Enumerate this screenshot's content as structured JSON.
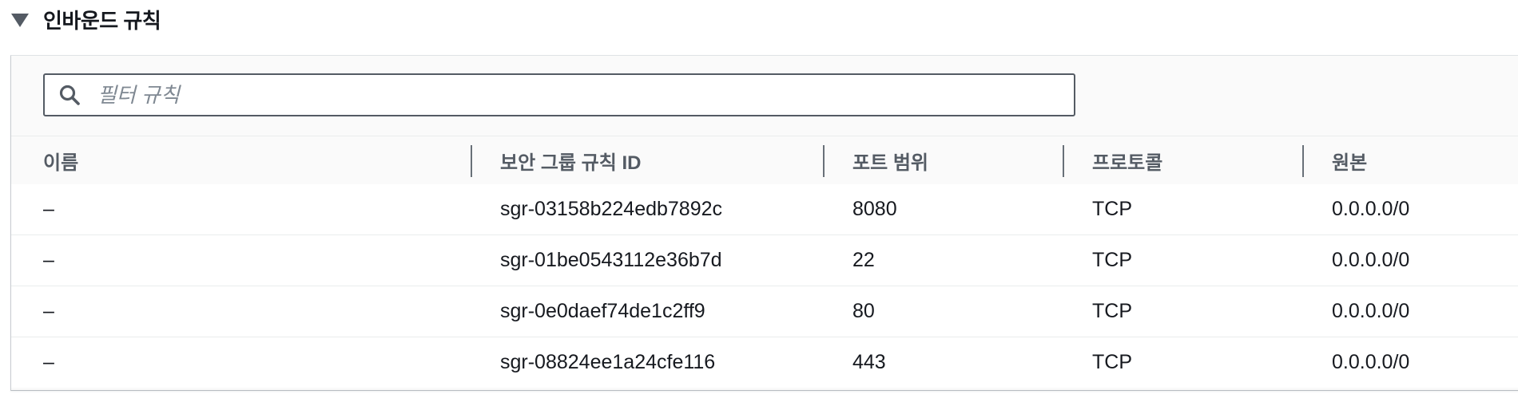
{
  "section": {
    "title": "인바운드 규칙"
  },
  "filter": {
    "placeholder": "필터 규칙",
    "value": ""
  },
  "table": {
    "columns": [
      "이름",
      "보안 그룹 규칙 ID",
      "포트 범위",
      "프로토콜",
      "원본"
    ],
    "rows": [
      [
        "–",
        "sgr-03158b224edb7892c",
        "8080",
        "TCP",
        "0.0.0.0/0"
      ],
      [
        "–",
        "sgr-01be0543112e36b7d",
        "22",
        "TCP",
        "0.0.0.0/0"
      ],
      [
        "–",
        "sgr-0e0daef74de1c2ff9",
        "80",
        "TCP",
        "0.0.0.0/0"
      ],
      [
        "–",
        "sgr-08824ee1a24cfe116",
        "443",
        "TCP",
        "0.0.0.0/0"
      ]
    ]
  },
  "icons": {
    "toggle": "caret-down-icon",
    "search": "search-icon"
  },
  "colors": {
    "header_text": "#545b64",
    "body_text": "#16191f",
    "input_border": "#545b64",
    "placeholder": "#7f8892",
    "row_divider": "#eaeded"
  }
}
